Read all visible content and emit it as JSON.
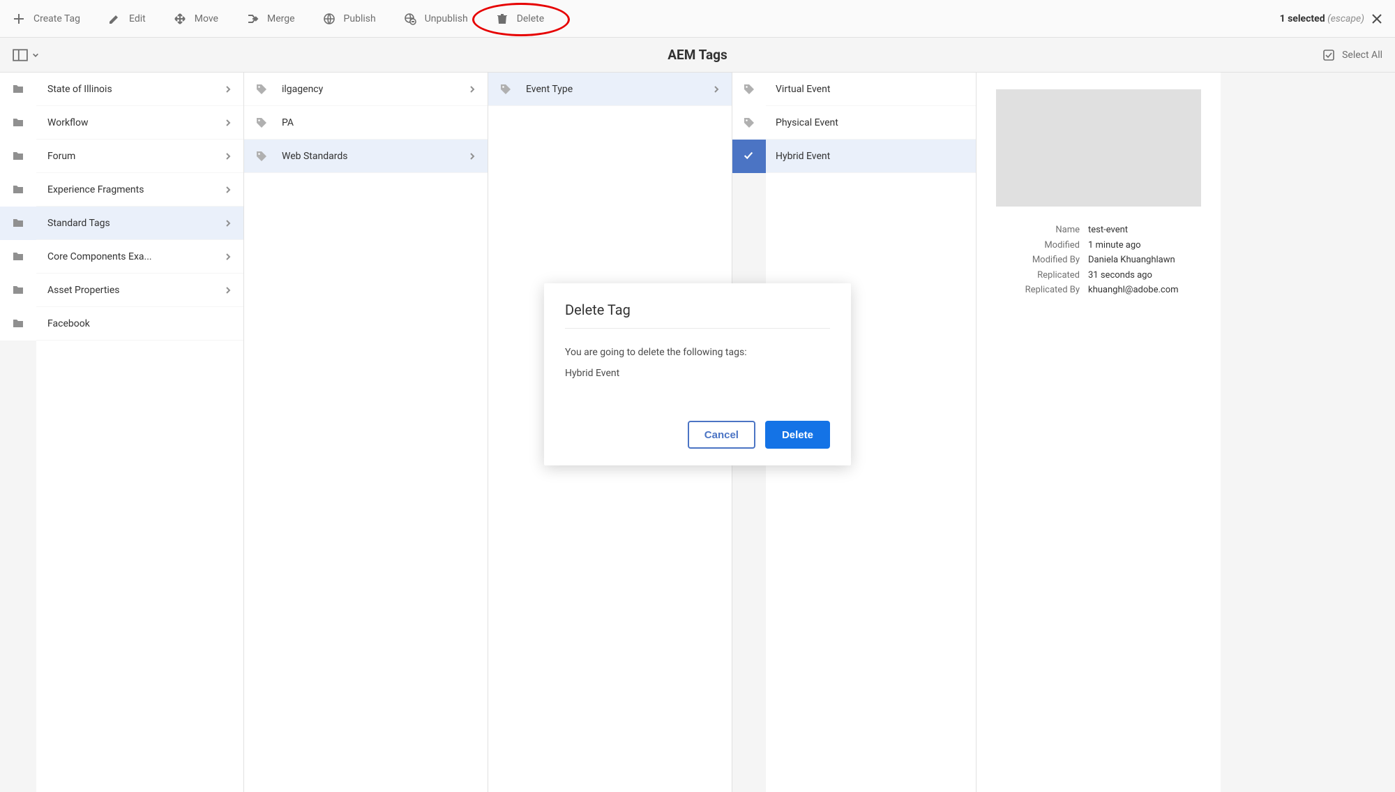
{
  "toolbar": {
    "create": "Create Tag",
    "edit": "Edit",
    "move": "Move",
    "merge": "Merge",
    "publish": "Publish",
    "unpublish": "Unpublish",
    "delete": "Delete",
    "selected_count": "1 selected",
    "escape": "(escape)"
  },
  "subheader": {
    "title": "AEM Tags",
    "select_all": "Select All"
  },
  "col1": [
    {
      "label": "State of Illinois",
      "has_children": true
    },
    {
      "label": "Workflow",
      "has_children": true
    },
    {
      "label": "Forum",
      "has_children": true
    },
    {
      "label": "Experience Fragments",
      "has_children": true
    },
    {
      "label": "Standard Tags",
      "has_children": true,
      "active": true
    },
    {
      "label": "Core Components Exa...",
      "has_children": true
    },
    {
      "label": "Asset Properties",
      "has_children": true
    },
    {
      "label": "Facebook",
      "has_children": false
    }
  ],
  "col2": [
    {
      "label": "ilgagency",
      "has_children": true
    },
    {
      "label": "PA",
      "has_children": false
    },
    {
      "label": "Web Standards",
      "has_children": true,
      "active": true
    }
  ],
  "col3": [
    {
      "label": "Event Type",
      "has_children": true,
      "active": true
    }
  ],
  "col4": [
    {
      "label": "Virtual Event",
      "has_children": false
    },
    {
      "label": "Physical Event",
      "has_children": false
    },
    {
      "label": "Hybrid Event",
      "has_children": false,
      "selected": true
    }
  ],
  "detail": {
    "props": [
      {
        "label": "Name",
        "value": "test-event"
      },
      {
        "label": "Modified",
        "value": "1 minute ago"
      },
      {
        "label": "Modified By",
        "value": "Daniela Khuanghlawn"
      },
      {
        "label": "Replicated",
        "value": "31 seconds ago"
      },
      {
        "label": "Replicated By",
        "value": "khuanghl@adobe.com"
      }
    ]
  },
  "dialog": {
    "title": "Delete Tag",
    "body": "You are going to delete the following tags:",
    "item": "Hybrid Event",
    "cancel": "Cancel",
    "delete": "Delete"
  }
}
